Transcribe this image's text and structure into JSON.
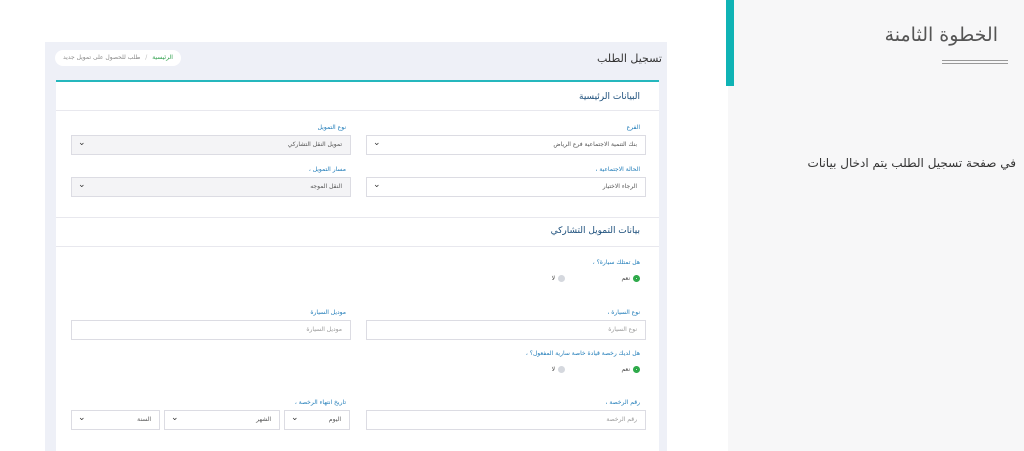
{
  "side": {
    "step_title": "الخطوة الثامنة",
    "description": "في صفحة تسجيل الطلب يتم ادخال بيانات"
  },
  "app": {
    "title": "تسجيل الطلب",
    "breadcrumb": {
      "home": "الرئيسية",
      "separator": "/",
      "current": "طلب للحصول على تمويل جديد"
    }
  },
  "main_section": {
    "title": "البيانات الرئيسية",
    "branch": {
      "label": "الفرع",
      "value": "بنك التنمية الاجتماعية فرع الرياض"
    },
    "financing_type": {
      "label": "نوع التمويل",
      "value": "تمويل النقل التشاركي"
    },
    "social_status": {
      "label": "الحالة الاجتماعية ،",
      "value": "الرجاء الاختيار"
    },
    "financing_path": {
      "label": "مسار التمويل ،",
      "value": "النقل الموجه"
    }
  },
  "participatory_section": {
    "title": "بيانات التمويل التشاركي",
    "own_car": {
      "label": "هل تمتلك سيارة؟ ،",
      "yes": "نعم",
      "no": "لا"
    },
    "car_type": {
      "label": "نوع السيارة ،",
      "placeholder": "نوع السيارة"
    },
    "car_model": {
      "label": "موديل السيارة",
      "placeholder": "موديل السيارة"
    },
    "license": {
      "label": "هل لديك رخصة قيادة خاصة سارية المفعول؟ ،",
      "yes": "نعم",
      "no": "لا"
    },
    "license_number": {
      "label": "رقم الرخصة ،",
      "placeholder": "رقم الرخصة"
    },
    "license_expiry": {
      "label": "تاريخ انتهاء الرخصة ،",
      "day": "اليوم",
      "month": "الشهر",
      "year": "السنة"
    }
  },
  "colors": {
    "accent": "#0fb3b5",
    "radio_selected": "#28a745",
    "section_title": "#1a4d7a"
  }
}
